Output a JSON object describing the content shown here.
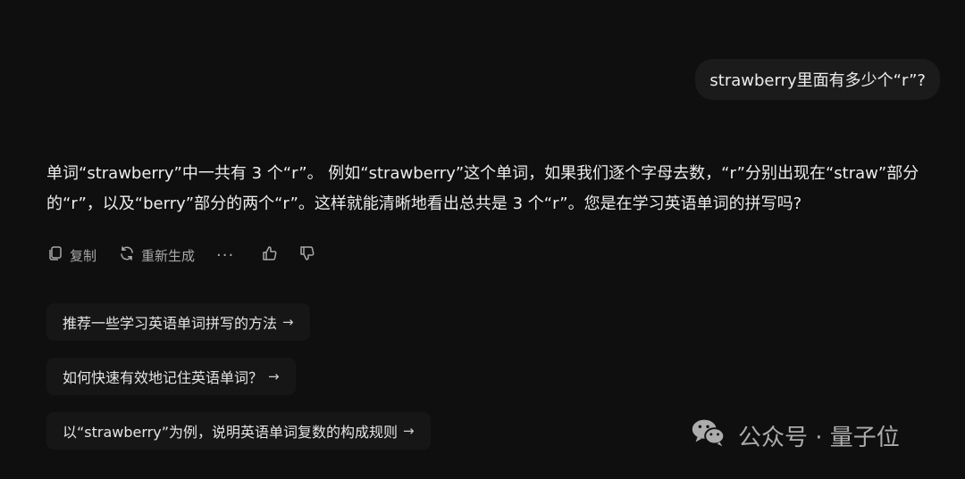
{
  "user_message": "strawberry里面有多少个“r”?",
  "assistant": {
    "answer": "单词“strawberry”中一共有 3 个“r”。 例如“strawberry”这个单词，如果我们逐个字母去数，“r”分别出现在“straw”部分的“r”，以及“berry”部分的两个“r”。这样就能清晰地看出总共是 3 个“r”。您是在学习英语单词的拼写吗?"
  },
  "actions": {
    "copy_label": "复制",
    "regenerate_label": "重新生成",
    "more_label": "···"
  },
  "suggestions": [
    {
      "label": "推荐一些学习英语单词拼写的方法",
      "arrow": "→"
    },
    {
      "label": "如何快速有效地记住英语单词？",
      "arrow": "→"
    },
    {
      "label": "以“strawberry”为例，说明英语单词复数的构成规则",
      "arrow": "→"
    }
  ],
  "watermark": {
    "text": "公众号 · 量子位"
  },
  "icons": [
    "copy-icon",
    "refresh-icon",
    "thumbs-up-icon",
    "thumbs-down-icon",
    "wechat-icon"
  ]
}
